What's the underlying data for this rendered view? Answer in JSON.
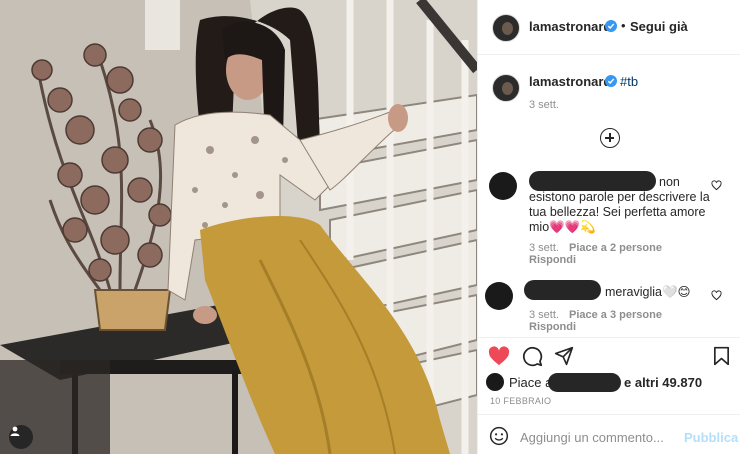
{
  "post": {
    "username": "lamastronardi",
    "separator": "•",
    "follow_label": "Segui già",
    "caption": "#tb",
    "caption_time": "3 sett.",
    "photo_alt": "photo"
  },
  "comments": [
    {
      "text": "non esistono parole per descrivere la tua bellezza! Sei perfetta amore mio💗💗💫",
      "line1": "non",
      "line2": "esistono parole per descrivere la",
      "line3": "tua bellezza! Sei perfetta amore",
      "line4": "mio💗💗💫",
      "time": "3 sett.",
      "likes": "Piace a 2 persone",
      "reply": "Rispondi"
    },
    {
      "text": "meraviglia🤍😊",
      "time": "3 sett.",
      "likes": "Piace a 3 persone",
      "reply": "Rispondi"
    }
  ],
  "actions": {
    "likes_prefix": "Piace a",
    "likes_suffix": "e altri 49.870",
    "date": "10 FEBBRAIO",
    "comment_placeholder": "Aggiungi un commento...",
    "publish_label": "Pubblica"
  },
  "icons": {
    "like": "heart-filled-icon",
    "comment": "comment-icon",
    "share": "share-icon",
    "save": "bookmark-icon",
    "emoji": "emoji-icon",
    "load_more": "plus-circle-icon",
    "tagged_user": "user-tag-icon",
    "verified": "verified-badge-icon"
  },
  "colors": {
    "heart": "#ed4956",
    "verified": "#3897f0",
    "link": "#00376b",
    "publish_disabled": "#b2dffc",
    "secondary_text": "#8e8e8e"
  }
}
